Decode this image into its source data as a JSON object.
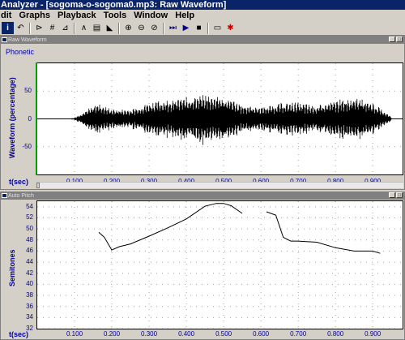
{
  "window": {
    "title": "Analyzer - [sogoma-o-sogoma0.mp3: Raw Waveform]"
  },
  "menu": {
    "items": [
      "dit",
      "Graphs",
      "Playback",
      "Tools",
      "Window",
      "Help"
    ]
  },
  "toolbar": {
    "buttons": [
      {
        "name": "info-icon",
        "glyph": "i"
      },
      {
        "name": "undo-icon",
        "glyph": "↶"
      },
      {
        "name": "sep"
      },
      {
        "name": "pitch-tool-icon",
        "glyph": "⊳"
      },
      {
        "name": "formant-tool-icon",
        "glyph": "#"
      },
      {
        "name": "spectrum-tool-icon",
        "glyph": "⊿"
      },
      {
        "name": "sep"
      },
      {
        "name": "graph-icon",
        "glyph": "∧"
      },
      {
        "name": "spectrogram-icon",
        "glyph": "▤"
      },
      {
        "name": "spectrum-icon",
        "glyph": "◣"
      },
      {
        "name": "sep"
      },
      {
        "name": "zoom-in-icon",
        "glyph": "⊕"
      },
      {
        "name": "zoom-out-icon",
        "glyph": "⊖"
      },
      {
        "name": "zoom-all-icon",
        "glyph": "⊘"
      },
      {
        "name": "sep"
      },
      {
        "name": "play-to-icon",
        "glyph": "⏭"
      },
      {
        "name": "play-icon",
        "glyph": "▶"
      },
      {
        "name": "stop-icon",
        "glyph": "■"
      },
      {
        "name": "sep"
      },
      {
        "name": "screen-icon",
        "glyph": "▭"
      },
      {
        "name": "record-icon",
        "glyph": "✱"
      }
    ]
  },
  "waveform_pane": {
    "title": "Raw Waveform",
    "phonetic_label": "Phonetic",
    "y_axis_label": "Waveform (percentage)",
    "y_ticks": [
      "50",
      "0",
      "-50"
    ],
    "x_axis_title": "t(sec)",
    "x_ticks": [
      "0.100",
      "0.200",
      "0.300",
      "0.400",
      "0.500",
      "0.600",
      "0.700",
      "0.800",
      "0.900"
    ]
  },
  "pitch_pane": {
    "title": "Auto Pitch",
    "y_axis_label": "Semitones",
    "y_ticks": [
      "54",
      "52",
      "50",
      "48",
      "46",
      "44",
      "42",
      "40",
      "38",
      "36",
      "34",
      "32"
    ],
    "x_axis_title": "t(sec)",
    "x_ticks": [
      "0.100",
      "0.200",
      "0.300",
      "0.400",
      "0.500",
      "0.600",
      "0.700",
      "0.800",
      "0.900"
    ]
  },
  "chart_data": [
    {
      "type": "line",
      "title": "",
      "ylabel": "Waveform (percentage)",
      "xlabel": "t(sec)",
      "xlim": [
        0.0,
        0.98
      ],
      "ylim": [
        -100,
        100
      ],
      "envelope": {
        "x": [
          0.04,
          0.08,
          0.1,
          0.13,
          0.16,
          0.2,
          0.25,
          0.3,
          0.35,
          0.4,
          0.45,
          0.5,
          0.55,
          0.6,
          0.65,
          0.7,
          0.75,
          0.8,
          0.85,
          0.9,
          0.95
        ],
        "amp": [
          0,
          0,
          2,
          12,
          25,
          15,
          14,
          25,
          30,
          33,
          38,
          34,
          22,
          18,
          24,
          25,
          20,
          28,
          35,
          25,
          3
        ]
      }
    },
    {
      "type": "line",
      "title": "",
      "ylabel": "Semitones",
      "xlabel": "t(sec)",
      "xlim": [
        0.0,
        0.98
      ],
      "ylim": [
        32,
        55
      ],
      "grid": true,
      "series": [
        {
          "x": [
            0.165,
            0.18,
            0.2,
            0.22,
            0.25,
            0.3,
            0.35,
            0.4,
            0.45,
            0.48,
            0.5,
            0.52,
            0.55
          ],
          "values": [
            49.4,
            48.5,
            46.2,
            46.8,
            47.3,
            48.7,
            50.2,
            51.8,
            54.1,
            54.6,
            54.6,
            54.2,
            52.8
          ]
        },
        {
          "x": [
            0.615,
            0.64,
            0.66,
            0.68,
            0.7,
            0.75,
            0.8,
            0.85,
            0.9,
            0.92
          ],
          "values": [
            53.1,
            52.5,
            48.5,
            47.8,
            47.8,
            47.6,
            46.6,
            46.0,
            46.0,
            45.6
          ]
        }
      ]
    }
  ]
}
